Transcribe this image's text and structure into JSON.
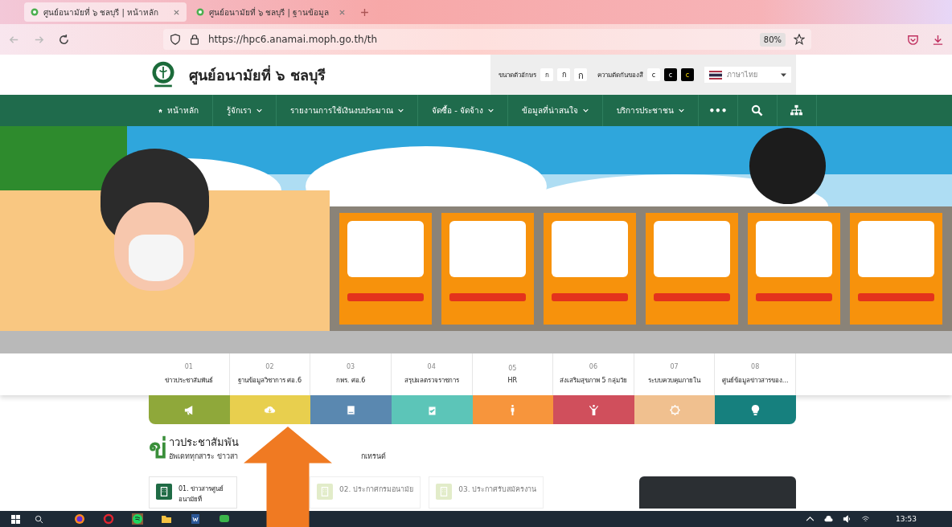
{
  "browser": {
    "tabs": [
      {
        "title": "ศูนย์อนามัยที่ ๖ ชลบุรี | หน้าหลัก",
        "selected": true
      },
      {
        "title": "ศูนย์อนามัยที่ ๖ ชลบุรี | ฐานข้อมูล",
        "selected": false
      }
    ],
    "url": "https://hpc6.anamai.moph.go.th/th",
    "zoom": "80%"
  },
  "header": {
    "title": "ศูนย์อนามัยที่ ๖ ชลบุรี",
    "font_size_label": "ขนาดตัวอักษร",
    "font_sizes": [
      "ก",
      "ก",
      "ก"
    ],
    "contrast_label": "ความตัดกันของสี",
    "contrast": [
      "c",
      "c",
      "c"
    ],
    "language": "ภาษาไทย"
  },
  "nav": [
    {
      "label": "หน้าหลัก",
      "kind": "home"
    },
    {
      "label": "รู้จักเรา",
      "kind": "menu"
    },
    {
      "label": "รายงานการใช้เงินงบประมาณ",
      "kind": "menu"
    },
    {
      "label": "จัดซื้อ - จัดจ้าง",
      "kind": "menu"
    },
    {
      "label": "ข้อมูลที่น่าสนใจ",
      "kind": "menu"
    },
    {
      "label": "บริการประชาชน",
      "kind": "menu"
    },
    {
      "label": "•••",
      "kind": "more"
    },
    {
      "kind": "search"
    },
    {
      "kind": "sitemap"
    }
  ],
  "quick_links": [
    {
      "number": "01",
      "label": "ข่าวประชาสัมพันธ์",
      "color": "#8fa83a"
    },
    {
      "number": "02",
      "label": "ฐานข้อมูลวิชาการ ศอ.6",
      "color": "#e8cf4e"
    },
    {
      "number": "03",
      "label": "กพร. ศอ.6",
      "color": "#5a88b0"
    },
    {
      "number": "04",
      "label": "สรุปผลตรวจราชการ",
      "color": "#5cc5b8"
    },
    {
      "number": "05",
      "label": "HR",
      "color": "#f7953c"
    },
    {
      "number": "06",
      "label": "ส่งเสริมสุขภาพ 5 กลุ่มวัย",
      "color": "#d04f5c"
    },
    {
      "number": "07",
      "label": "ระบบควบคุมภายใน",
      "color": "#f0c08f"
    },
    {
      "number": "08",
      "label": "ศูนย์ข้อมูลข่าวสารของ...",
      "color": "#16807e"
    }
  ],
  "news": {
    "heading_initial": "ข่",
    "heading_rest": "าวประชาสัมพัน",
    "subtitle": [
      "อัพเดททุกสาระ ข่าวสา",
      "กเทรนด์"
    ],
    "cards": [
      {
        "title": "01. ข่าวสารศูนย์อนามัยที่",
        "selected": true
      },
      {
        "title": "02. ประกาศกรมอนามัย",
        "selected": false
      },
      {
        "title": "03. ประกาศรับสมัครงาน",
        "selected": false
      }
    ]
  },
  "taskbar": {
    "time": "13:53"
  }
}
